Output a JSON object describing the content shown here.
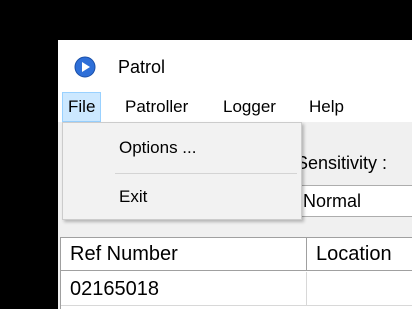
{
  "window": {
    "title": "Patrol",
    "icon": "play-circle-icon"
  },
  "menubar": {
    "items": [
      {
        "label": "File"
      },
      {
        "label": "Patroller"
      },
      {
        "label": "Logger"
      },
      {
        "label": "Help"
      }
    ]
  },
  "file_menu": {
    "items": [
      {
        "label": "Options ..."
      },
      {
        "label": "Exit"
      }
    ]
  },
  "sensitivity": {
    "label": "Sensitivity :",
    "value": "Normal"
  },
  "grid": {
    "columns": [
      "Ref Number",
      "Location"
    ],
    "rows": [
      [
        "02165018",
        ""
      ]
    ]
  },
  "colors": {
    "accent": "#cce8ff",
    "icon_blue": "#2e6fd8"
  }
}
